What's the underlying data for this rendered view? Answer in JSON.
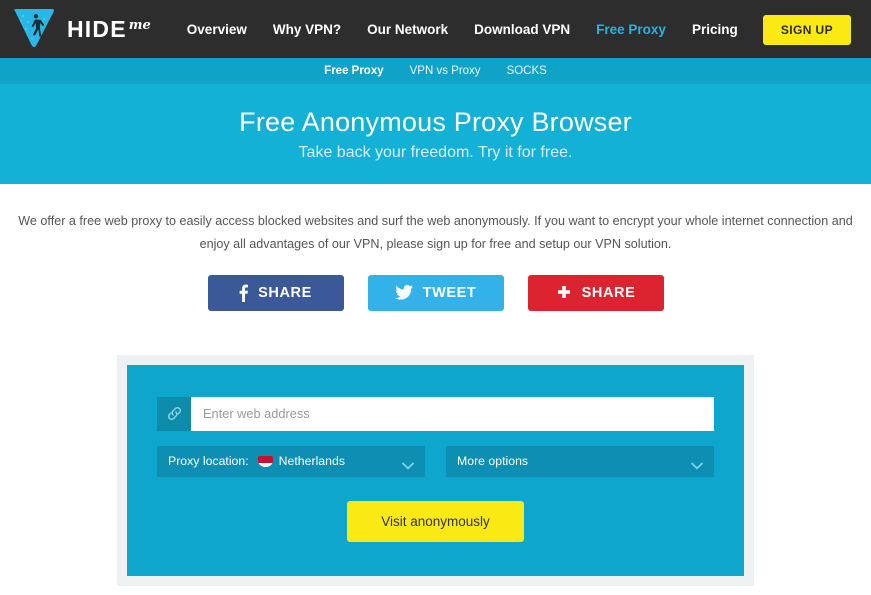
{
  "brand": {
    "name_primary": "HIDE",
    "name_secondary": "me",
    "logo_icon": "hide-me-triangle-logo"
  },
  "nav": {
    "items": [
      {
        "label": "Overview",
        "active": false
      },
      {
        "label": "Why VPN?",
        "active": false
      },
      {
        "label": "Our Network",
        "active": false
      },
      {
        "label": "Download VPN",
        "active": false
      },
      {
        "label": "Free Proxy",
        "active": true
      },
      {
        "label": "Pricing",
        "active": false
      }
    ],
    "signup_label": "SIGN UP"
  },
  "subnav": {
    "items": [
      {
        "label": "Free Proxy",
        "active": true
      },
      {
        "label": "VPN vs Proxy",
        "active": false
      },
      {
        "label": "SOCKS",
        "active": false
      }
    ]
  },
  "hero": {
    "title": "Free Anonymous Proxy Browser",
    "subtitle": "Take back your freedom. Try it for free."
  },
  "intro": {
    "text": "We offer a free web proxy to easily access blocked websites and surf the web anonymously. If you want to encrypt your whole internet connection and enjoy all advantages of our VPN, please sign up for free and setup our VPN solution."
  },
  "share": {
    "buttons": [
      {
        "label": "SHARE",
        "network": "facebook",
        "icon": "facebook-f-icon",
        "color": "#3b5998"
      },
      {
        "label": "TWEET",
        "network": "twitter",
        "icon": "twitter-bird-icon",
        "color": "#32b2e8"
      },
      {
        "label": "SHARE",
        "network": "googleplus",
        "icon": "plus-icon",
        "color": "#dc2430"
      }
    ]
  },
  "proxy_form": {
    "url_icon": "link-chain-icon",
    "url_placeholder": "Enter web address",
    "url_value": "",
    "location_label": "Proxy location:",
    "location_value": "Netherlands",
    "location_flag": "netherlands-flag-icon",
    "more_options_label": "More options",
    "chevron_icon": "chevron-down-icon",
    "submit_label": "Visit anonymously"
  },
  "colors": {
    "topbar": "#2d2d2d",
    "accent_cyan": "#14b1d6",
    "subnav": "#0fa3c8",
    "panel": "#0fa6ce",
    "select": "#0d8fb3",
    "yellow": "#fbe914",
    "nav_active": "#23b6dd"
  }
}
